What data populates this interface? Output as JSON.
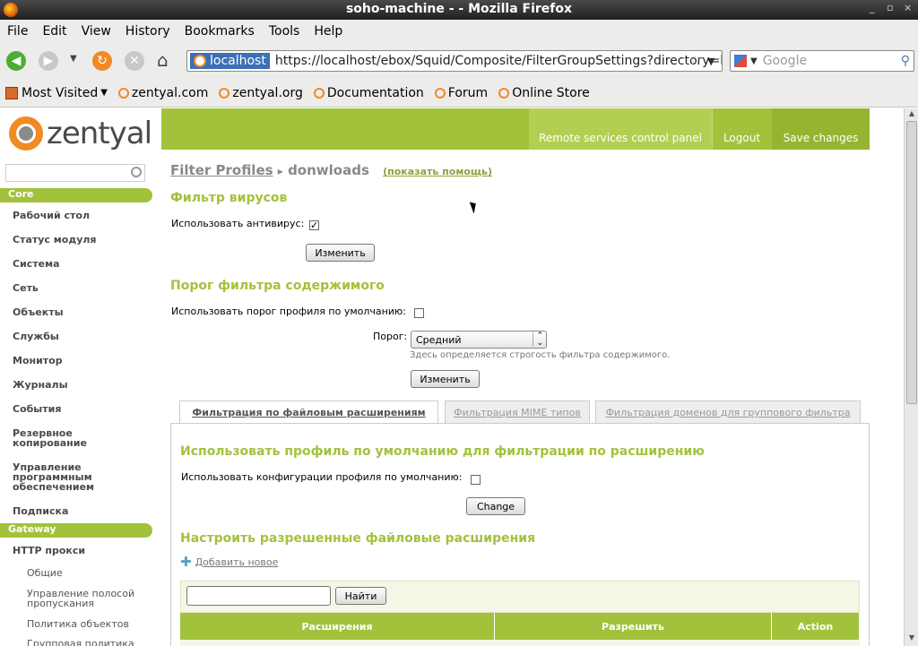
{
  "window": {
    "title": "soho-machine - - Mozilla Firefox",
    "controls": [
      "_",
      "▫",
      "×"
    ]
  },
  "menu": [
    "File",
    "Edit",
    "View",
    "History",
    "Bookmarks",
    "Tools",
    "Help"
  ],
  "nav": {
    "site": "localhost",
    "url": "https://localhost/ebox/Squid/Composite/FilterGroupSettings?directory=l",
    "search_placeholder": "Google"
  },
  "bookmarks": [
    "Most Visited",
    "zentyal.com",
    "zentyal.org",
    "Documentation",
    "Forum",
    "Online Store"
  ],
  "header": {
    "logo": "zentyal",
    "links": [
      "Remote services control panel",
      "Logout",
      "Save changes"
    ]
  },
  "sidebar": {
    "sections": [
      {
        "label": "Core"
      },
      {
        "label": "Gateway"
      }
    ],
    "core_items": [
      "Рабочий стол",
      "Статус модуля",
      "Система",
      "Сеть",
      "Объекты",
      "Службы",
      "Монитор",
      "Журналы",
      "События",
      "Резервное копирование",
      "Управление программным обеспечением",
      "Подписка"
    ],
    "gateway_items": [
      "HTTP прокси"
    ],
    "sub_items": [
      "Общие",
      "Управление полосой пропускания",
      "Политика объектов",
      "Групповая политика"
    ]
  },
  "main": {
    "breadcrumb_link": "Filter Profiles",
    "breadcrumb_sep": "▸",
    "breadcrumb_current": "donwloads",
    "help_link": "(показать помощь)",
    "virus": {
      "heading": "Фильтр вирусов",
      "label": "Использовать антивирус:",
      "checked": true,
      "button": "Изменить"
    },
    "threshold": {
      "heading": "Порог фильтра содержимого",
      "default_label": "Использовать порог профиля по умолчанию:",
      "default_checked": false,
      "select_label": "Порог:",
      "select_value": "Средний",
      "hint": "Здесь определяется строгость фильтра содержимого.",
      "button": "Изменить"
    },
    "tabs": [
      "Фильтрация по файловым расширениям",
      "Фильтрация MIME типов",
      "Фильтрация доменов для группового фильтра"
    ],
    "ext": {
      "heading": "Использовать профиль по умолчанию для фильтрации по расширению",
      "label": "Использовать конфигурации профиля по умолчанию:",
      "checked": false,
      "button": "Change",
      "allowed_heading": "Настроить разрешенные файловые расширения",
      "add_new": "Добавить новое",
      "search_button": "Найти",
      "columns": [
        "Расширения",
        "Разрешить",
        "Action"
      ]
    }
  }
}
